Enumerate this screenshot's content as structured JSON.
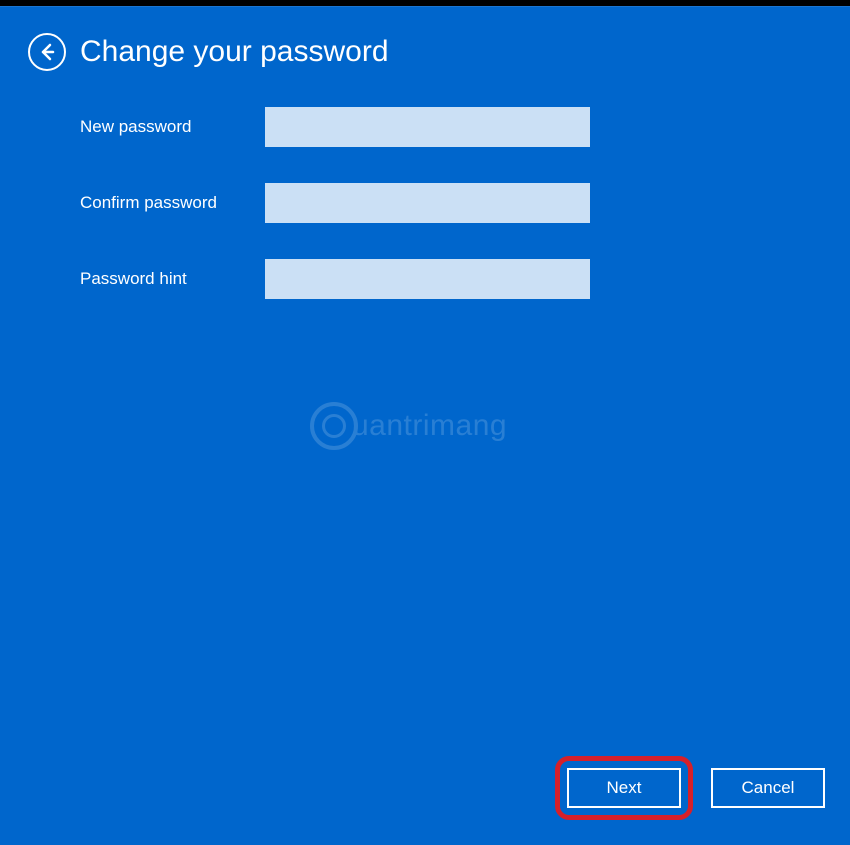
{
  "header": {
    "title": "Change your password"
  },
  "form": {
    "new_password": {
      "label": "New password",
      "value": ""
    },
    "confirm_password": {
      "label": "Confirm password",
      "value": ""
    },
    "password_hint": {
      "label": "Password hint",
      "value": ""
    }
  },
  "watermark": {
    "text": "uantrimang"
  },
  "buttons": {
    "next": "Next",
    "cancel": "Cancel"
  }
}
